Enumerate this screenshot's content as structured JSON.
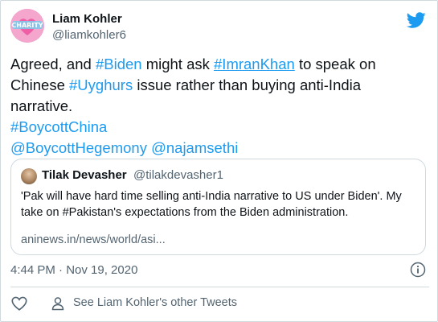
{
  "author": {
    "name": "Liam Kohler",
    "handle": "@liamkohler6",
    "avatar_text": "CHARITY"
  },
  "tweet": {
    "line1": {
      "pre": "Agreed, and ",
      "tag1": "#Biden",
      "mid": " might ask ",
      "tag2": "#ImranKhan",
      "post": " to speak on"
    },
    "line2": {
      "pre": "Chinese ",
      "tag": "#Uyghurs",
      "post": " issue rather than buying anti-India"
    },
    "line3": "narrative.",
    "line4": "#BoycottChina",
    "line5": {
      "mention1": "@BoycottHegemony",
      "space": " ",
      "mention2": "@najamsethi"
    }
  },
  "quote": {
    "name": "Tilak Devasher",
    "handle": "@tilakdevasher1",
    "text": "'Pak will have hard time selling anti-India narrative to US under Biden'. My take on #Pakistan's expectations from the Biden administration.",
    "link": "aninews.in/news/world/asi..."
  },
  "meta": {
    "timestamp": "4:44 PM · Nov 19, 2020"
  },
  "footer": {
    "see_more": "See Liam Kohler's other Tweets"
  },
  "colors": {
    "link": "#1d9bf0",
    "secondary_text": "#536471",
    "border": "#cfd9de"
  },
  "icons": {
    "brand": "twitter-bird-icon",
    "info": "info-icon",
    "like": "heart-icon",
    "profile": "person-icon"
  }
}
